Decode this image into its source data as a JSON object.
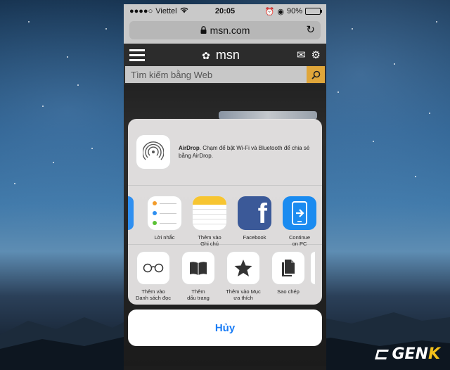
{
  "status_bar": {
    "carrier": "Viettel",
    "time": "20:05",
    "battery": "90%",
    "battery_level": 0.9
  },
  "browser": {
    "url": "msn.com"
  },
  "msn": {
    "logo": "msn",
    "search_placeholder": "Tìm kiếm bằng Web"
  },
  "share_sheet": {
    "airdrop": {
      "title": "AirDrop",
      "description": ". Chạm để bật Wi-Fi và Bluetooth để chia sẻ bằng AirDrop."
    },
    "apps": [
      {
        "label": "Lời nhắc",
        "icon": "reminders-icon"
      },
      {
        "label": "Thêm vào\nGhi chú",
        "icon": "notes-icon"
      },
      {
        "label": "Facebook",
        "icon": "facebook-icon"
      },
      {
        "label": "Continue\non PC",
        "icon": "continue-on-pc-icon"
      }
    ],
    "actions": [
      {
        "label": "Thêm vào\nDanh sách đọc",
        "icon": "glasses-icon"
      },
      {
        "label": "Thêm\ndấu trang",
        "icon": "book-icon"
      },
      {
        "label": "Thêm vào Mục\nưa thích",
        "icon": "star-icon"
      },
      {
        "label": "Sao chép",
        "icon": "copy-icon"
      }
    ],
    "cancel_label": "Hủy"
  },
  "watermark": {
    "ge": "GEN",
    "k": "K"
  },
  "colors": {
    "ios_blue": "#1a7cf5",
    "facebook": "#3b5998",
    "msn_search_button": "#e0a63a",
    "notes_yellow": "#f7c531"
  }
}
